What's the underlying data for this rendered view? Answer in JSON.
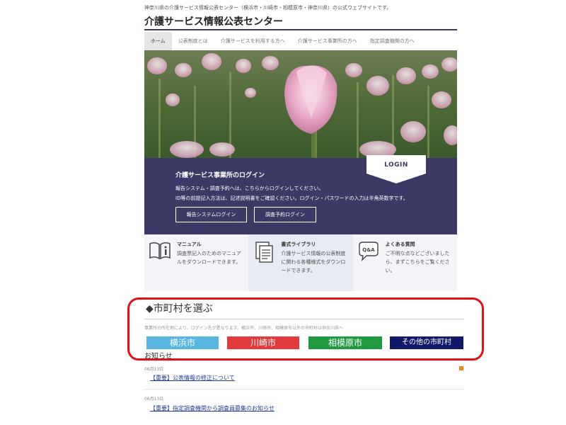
{
  "header": {
    "topline": "神奈川県の介護サービス情報公表センター（横浜市・川崎市・相模原市・神奈川県）の公式ウェブサイトです。",
    "site_title": "介護サービス情報公表センター"
  },
  "nav": {
    "items": [
      {
        "label": "ホーム"
      },
      {
        "label": "公表制度とは"
      },
      {
        "label": "介護サービスを利用する方へ"
      },
      {
        "label": "介護サービス事業所の方へ"
      },
      {
        "label": "指定調査機関の方へ"
      }
    ]
  },
  "login": {
    "tag": "LOGIN",
    "heading": "介護サービス事業所のログイン",
    "desc_line1": "報告システム・調査予約へは、こちらからログインしてください。",
    "desc_line2": "ID等の前提記入方法は、記述説明書をご確認ください。ログイン・パスワードの入力は半角英数字です。",
    "button_report": "報告システムログイン",
    "button_survey": "調査予約ログイン"
  },
  "tiles": [
    {
      "icon": "manual-book-icon",
      "title": "マニュアル",
      "text": "調査票記入のためのマニュアルをダウンロードできます。"
    },
    {
      "icon": "document-library-icon",
      "title": "書式ライブラリ",
      "text": "介護サービス情報の公表制度に関わる各種様式をダウンロードできます。"
    },
    {
      "icon": "qa-bubble-icon",
      "title": "よくある質問",
      "text": "ご不明な点などございましたら、まずこちらをご覧ください。"
    }
  ],
  "municipality": {
    "heading": "◆市町村を選ぶ",
    "note": "事業所の所在地により、ログイン先が異なります。横浜市、川崎市、相模原市以外の市町村は神奈川県へ",
    "cities": [
      {
        "label": "横浜市",
        "color": "#57b6e2"
      },
      {
        "label": "川崎市",
        "color": "#e23a3a"
      },
      {
        "label": "相模原市",
        "color": "#1f9a3f"
      },
      {
        "label": "その他の市町村",
        "color": "#0f1869"
      }
    ]
  },
  "news": {
    "heading": "お知らせ",
    "items": [
      {
        "date": "06月13日",
        "title": "【重要】公表情報の修正について"
      },
      {
        "date": "06月13日",
        "title": "【重要】指定調査機関から調査員募集のお知らせ"
      }
    ]
  },
  "colors": {
    "accent": "#3b3a66",
    "highlight": "#e3101a"
  }
}
